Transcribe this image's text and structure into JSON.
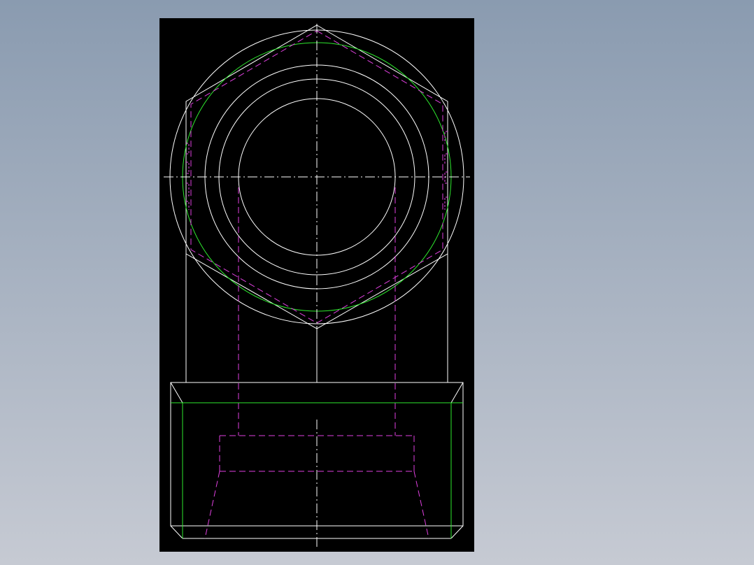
{
  "colors": {
    "background_gradient_top": "#8a9bb0",
    "background_gradient_bottom": "#c6cad3",
    "canvas": "#000000",
    "outline": "#ffffff",
    "thread_circle": "#2ee82e",
    "hidden_line": "#e040e0"
  },
  "drawing": {
    "views": [
      "top-view-circular-port",
      "front-view-base-block"
    ],
    "line_types": [
      "visible-outline",
      "hidden-dashed",
      "centerline-dash-dot"
    ]
  }
}
